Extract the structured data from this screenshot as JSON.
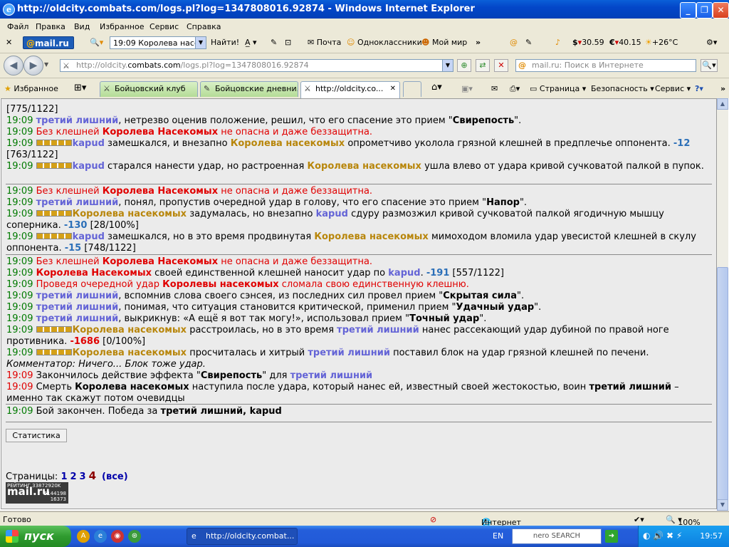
{
  "window": {
    "title": "http://oldcity.combats.com/logs.pl?log=1347808016.92874 - Windows Internet Explorer",
    "minimize": "_",
    "maximize": "❐",
    "close": "✕"
  },
  "menu": [
    "Файл",
    "Правка",
    "Вид",
    "Избранное",
    "Сервис",
    "Справка"
  ],
  "mailbar": {
    "logo": "mail.ru",
    "search_value": "19:09 Королева насек",
    "find_label": "Найти!",
    "links": [
      "Почта",
      "Одноклассники",
      "Мой мир"
    ],
    "more": "»",
    "currency_usd": "30.59",
    "currency_eur": "40.15",
    "weather": "+26°C"
  },
  "address": {
    "url_prefix": "http://oldcity.",
    "url_host": "combats.com",
    "url_path": "/logs.pl?log=1347808016.92874",
    "search_placeholder": "mail.ru: Поиск в Интернете"
  },
  "tabs": {
    "favorites_label": "Избранное",
    "items": [
      {
        "label": "Бойцовский клуб"
      },
      {
        "label": "Бойцовские дневни..."
      },
      {
        "label": "http://oldcity.co..."
      }
    ],
    "tools": [
      "Страница ▾",
      "Безопасность ▾",
      "Сервис ▾"
    ]
  },
  "log": {
    "top_line": "[775/1122]",
    "groups": [
      [
        {
          "time": "19:09",
          "parts": [
            [
              "blue",
              "третий лишний"
            ],
            [
              "",
              ".",
              " нетрезво оценив положение, решил, что его спасение это прием \""
            ],
            [
              "b",
              "Свирепость"
            ],
            [
              "",
              "\"."
            ]
          ]
        }
      ]
    ],
    "lines": {
      "l1": "нетрезво оценив положение, решил, что его спасение это прием",
      "l1_skill": "Свирепость",
      "defenseless": "Без клешней",
      "queen_cap": "Королева Насекомых",
      "queen": "Королева насекомых",
      "not_dangerous": "не опасна и даже беззащитна.",
      "kapud": "kapud",
      "third": "третий лишний",
      "l3a": "замешкался, и внезапно",
      "l3b": "опрометчиво уколола грязной клешней в предплечье оппонента.",
      "l3dmg": "-12",
      "l3hp": "[763/1122]",
      "l4a": "старался нанести удар, но растроенная",
      "l4b": "ушла влево от удара кривой сучковатой палкой в пупок.",
      "l6a": ", понял, пропустив очередной удар в голову, что его спасение это прием",
      "l6skill": "Напор",
      "l7a": "задумалась, но внезапно",
      "l7b": "сдуру размозжил кривой сучковатой палкой ягодичную мышцу соперника.",
      "l7dmg": "-130",
      "l7hp": "[28/100%]",
      "l8a": "замешкался, но в это время продвинутая",
      "l8b": "мимоходом вломила удар увесистой клешней в скулу оппонента.",
      "l8dmg": "-15",
      "l8hp": "[748/1122]",
      "l10a": "своей единственной клешней наносит удар по",
      "l10dmg": "-191",
      "l10hp": "[557/1122]",
      "l11a": "Проведя очередной удар",
      "l11q": "Королевы насекомых",
      "l11b": "сломала свою единственную клешню.",
      "l12a": ", вспомнив слова своего сэнсея, из последних сил провел прием",
      "l12skill": "Скрытая сила",
      "l13a": ", понимая, что ситуация становится критической, применил прием",
      "l13skill": "Удачный удар",
      "l14a": ", выкрикнув: «А ещё я вот так могу!», использовал прием",
      "l14skill": "Точный удар",
      "l15a": "расстроилась, но в это время",
      "l15b": "нанес рассекающий удар дубиной по правой ноге противника.",
      "l15dmg": "-1686",
      "l15hp": "[0/100%]",
      "l16a": "просчиталась и хитрый",
      "l16b": "поставил блок на удар грязной клешней по печени.",
      "comment": "Комментатор: Ничего... Блок тоже удар.",
      "l18a": "Закончилось действие эффекта",
      "l18skill": "Свирепость",
      "l18b": "для",
      "l19a": "Смерть",
      "l19b": "наступила после удара, который нанес ей, известный своей жестокостью, воин",
      "l19c": "– именно так скажут потом очевидцы",
      "final_a": "Бой закончен. Победа за",
      "final_b": "третий лишний, kapud",
      "time": "19:09"
    }
  },
  "stats_button": "Статистика",
  "pagination": {
    "label": "Страницы:",
    "pages": [
      "1",
      "2",
      "3"
    ],
    "current": "4",
    "all": "(все)"
  },
  "counter": {
    "label": "РЕЙТИНГ 33872920K",
    "logo": "mail.ru",
    "n1": "5144198",
    "n2": "16373"
  },
  "status": {
    "left": "Готово",
    "zone": "Интернет",
    "zoom": "100%"
  },
  "taskbar": {
    "start": "пуск",
    "item": "http://oldcity.combat...",
    "lang": "EN",
    "search": "nero SEARCH",
    "clock": "19:57"
  },
  "colors": {
    "timestamp": "#007a00",
    "red": "#e00000",
    "player": "#6464d6",
    "monster": "#b8860b",
    "damage": "#2b6fb8"
  }
}
